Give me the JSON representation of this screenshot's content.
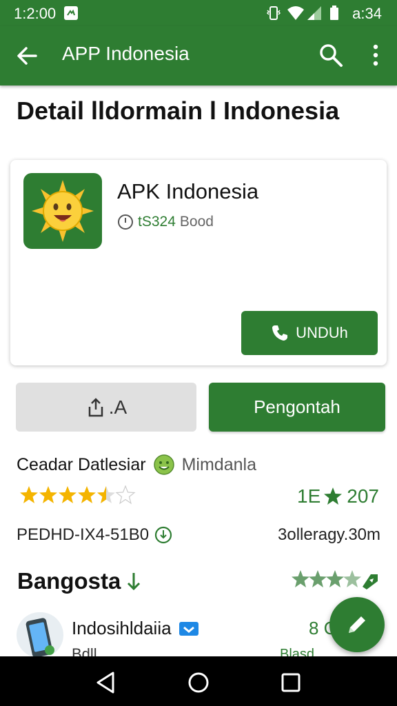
{
  "status_bar": {
    "time": "1:2:00",
    "clock": "a:34"
  },
  "app_bar": {
    "title": "APP Indonesia"
  },
  "page": {
    "title": "Detail lldormain l Indonesia"
  },
  "app_card": {
    "name": "APK Indonesia",
    "price": "tS324",
    "size": "Bood",
    "install_label": "UNDUh"
  },
  "actions": {
    "share_label": ".A",
    "primary_label": "Pengontah"
  },
  "developer": {
    "label": "Ceadar Datlesiar",
    "category": "Mimdanla"
  },
  "rating": {
    "stars": 3.5,
    "value_left": "1E",
    "value_right": "207"
  },
  "version": {
    "text": "PEDHD-IX4-51B0"
  },
  "installs": {
    "text": "3olleragy.30m"
  },
  "section": {
    "title": "Bangosta"
  },
  "list_item": {
    "name": "Indosihldaiia",
    "value": "8 C",
    "sub": "Bdll...",
    "sub2": "Blasd..."
  },
  "colors": {
    "primary": "#2e7d32",
    "star": "#f4b400"
  }
}
